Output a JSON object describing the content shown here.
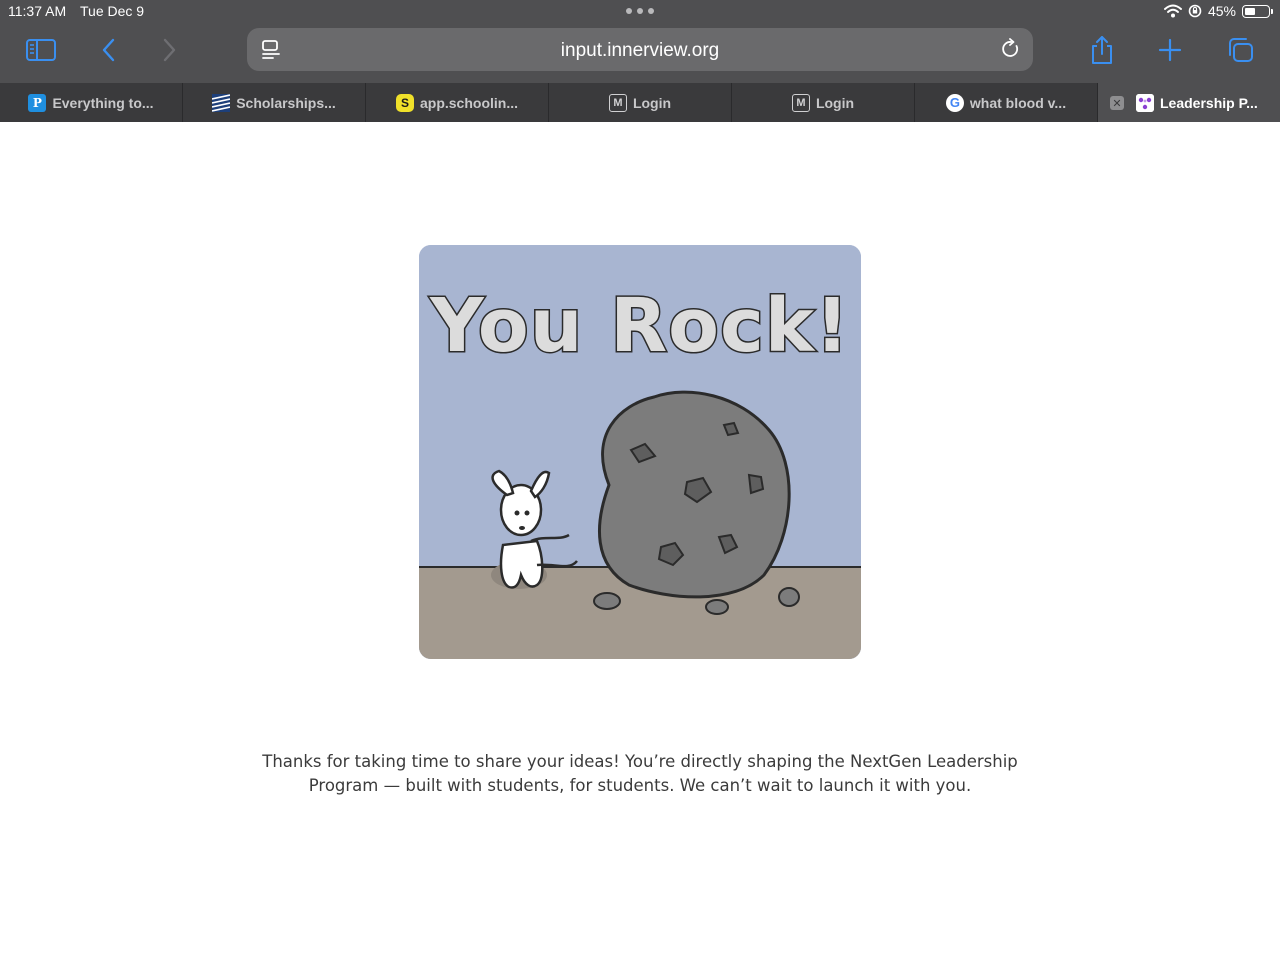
{
  "status_bar": {
    "time": "11:37 AM",
    "date": "Tue Dec 9",
    "battery": "45%",
    "battery_level": 0.45
  },
  "toolbar": {
    "url": "input.innerview.org",
    "accent_color": "#3a8ff0"
  },
  "tabs": [
    {
      "label": "Everything to...",
      "icon": "p-icon",
      "active": false
    },
    {
      "label": "Scholarships...",
      "icon": "stripes-icon",
      "active": false
    },
    {
      "label": "app.schoolin...",
      "icon": "schoolinks-icon",
      "active": false
    },
    {
      "label": "Login",
      "icon": "m-icon",
      "active": false
    },
    {
      "label": "Login",
      "icon": "m-icon",
      "active": false
    },
    {
      "label": "what blood v...",
      "icon": "google-icon",
      "active": false
    },
    {
      "label": "Leadership P...",
      "icon": "leadership-icon",
      "active": true
    }
  ],
  "page": {
    "image_text": "You Rock!",
    "message": "Thanks for taking  time to share your ideas! You’re directly shaping the NextGen Leadership Program — built with students, for students. We can’t wait to launch it with you."
  }
}
